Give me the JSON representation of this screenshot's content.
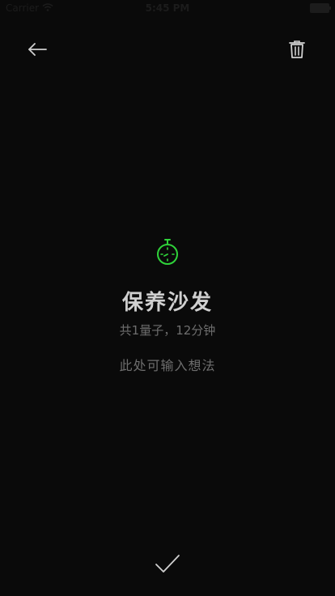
{
  "status_bar": {
    "carrier": "Carrier",
    "time": "5:45 PM"
  },
  "icons": {
    "back": "arrow-left-icon",
    "delete": "trash-icon",
    "timer": "stopwatch-icon",
    "confirm": "checkmark-icon"
  },
  "colors": {
    "background": "#0a0a0a",
    "accent_green": "#2fd33a",
    "icon_light": "#d0d0d0",
    "muted_text": "#6e6e6e"
  },
  "task": {
    "title": "保养沙发",
    "summary": "共1量子，12分钟",
    "note_placeholder": "此处可输入想法"
  }
}
